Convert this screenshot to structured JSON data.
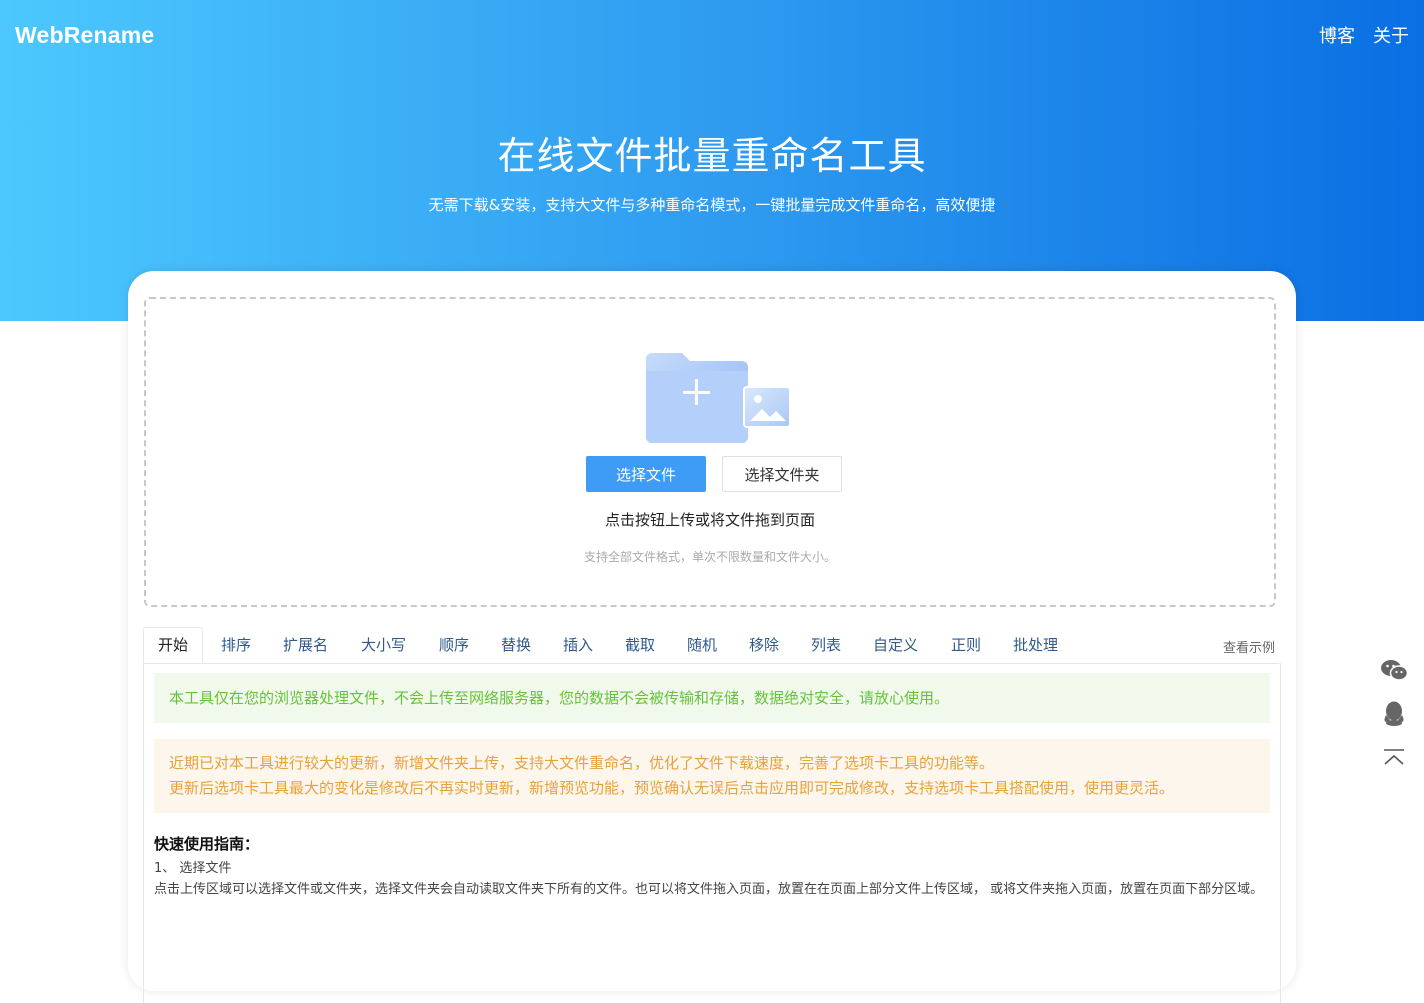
{
  "brand": "WebRename",
  "nav": {
    "blog": "博客",
    "about": "关于"
  },
  "hero": {
    "title": "在线文件批量重命名工具",
    "subtitle": "无需下载&安装，支持大文件与多种重命名模式，一键批量完成文件重命名，高效便捷"
  },
  "upload": {
    "select_file": "选择文件",
    "select_folder": "选择文件夹",
    "hint": "点击按钮上传或将文件拖到页面",
    "subhint": "支持全部文件格式，单次不限数量和文件大小。"
  },
  "tabs": [
    {
      "label": "开始"
    },
    {
      "label": "排序"
    },
    {
      "label": "扩展名"
    },
    {
      "label": "大小写"
    },
    {
      "label": "顺序"
    },
    {
      "label": "替换"
    },
    {
      "label": "插入"
    },
    {
      "label": "截取"
    },
    {
      "label": "随机"
    },
    {
      "label": "移除"
    },
    {
      "label": "列表"
    },
    {
      "label": "自定义"
    },
    {
      "label": "正则"
    },
    {
      "label": "批处理"
    }
  ],
  "view_example": "查看示例",
  "notices": {
    "success": "本工具仅在您的浏览器处理文件，不会上传至网络服务器，您的数据不会被传输和存储，数据绝对安全，请放心使用。",
    "update_line1": "近期已对本工具进行较大的更新，新增文件夹上传，支持大文件重命名，优化了文件下载速度，完善了选项卡工具的功能等。",
    "update_line2": "更新后选项卡工具最大的变化是修改后不再实时更新，新增预览功能，预览确认无误后点击应用即可完成修改，支持选项卡工具搭配使用，使用更灵活。"
  },
  "guide": {
    "title": "快速使用指南：",
    "step1_title": "1、 选择文件",
    "step1_text": "点击上传区域可以选择文件或文件夹，选择文件夹会自动读取文件夹下所有的文件。也可以将文件拖入页面，放置在在页面上部分文件上传区域， 或将文件夹拖入页面，放置在页面下部分区域。"
  },
  "side_tools": [
    "wechat-icon",
    "qq-icon",
    "back-to-top-icon"
  ],
  "colors": {
    "primary": "#3f9cf6",
    "success_text": "#67c23a",
    "warning_text": "#e6a23c"
  }
}
